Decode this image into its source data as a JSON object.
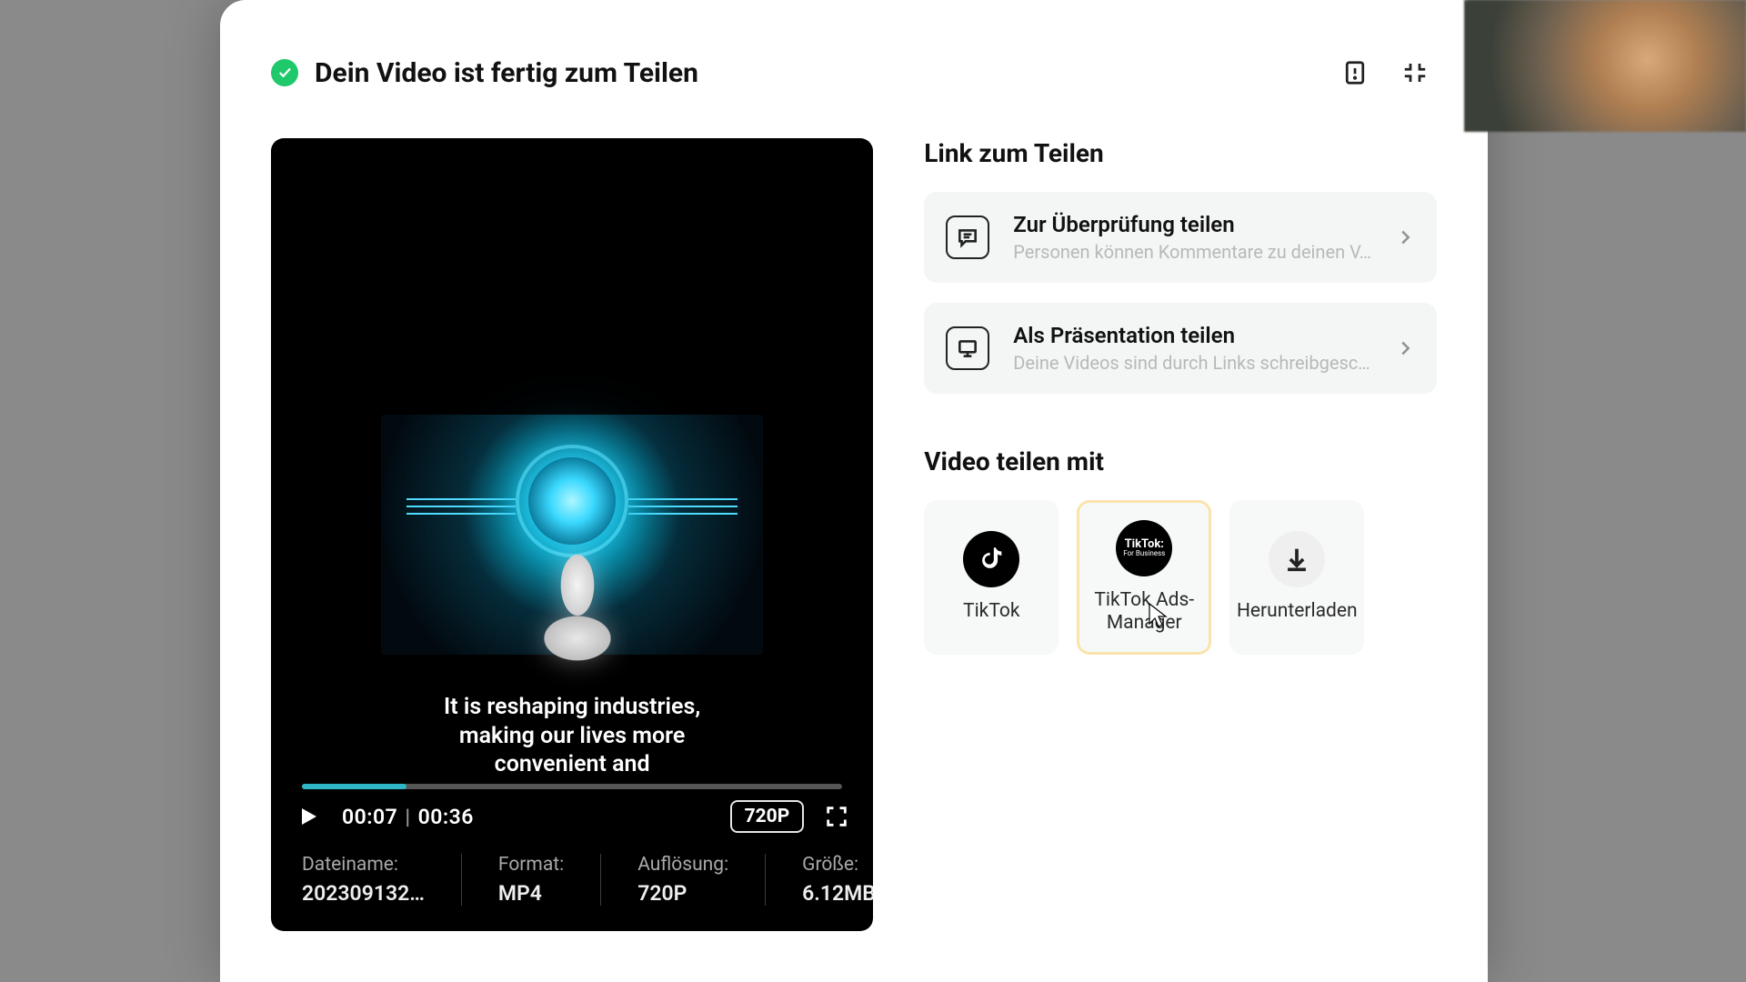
{
  "header": {
    "title": "Dein Video ist fertig zum Teilen"
  },
  "video": {
    "caption": "It is reshaping industries,\nmaking our lives more\nconvenient and",
    "current_time": "00:07",
    "duration": "00:36",
    "quality_badge": "720P",
    "meta": {
      "filename_label": "Dateiname:",
      "filename_value": "202309132…",
      "format_label": "Format:",
      "format_value": "MP4",
      "resolution_label": "Auflösung:",
      "resolution_value": "720P",
      "size_label": "Größe:",
      "size_value": "6.12MB"
    }
  },
  "link_section": {
    "title": "Link zum Teilen",
    "items": [
      {
        "title": "Zur Überprüfung teilen",
        "subtitle": "Personen können Kommentare zu deinen V…"
      },
      {
        "title": "Als Präsentation teilen",
        "subtitle": "Deine Videos sind durch Links schreibgesc…"
      }
    ]
  },
  "share_section": {
    "title": "Video teilen mit",
    "items": [
      {
        "label": "TikTok"
      },
      {
        "label": "TikTok Ads-Manager"
      },
      {
        "label": "Herunterladen"
      }
    ]
  }
}
